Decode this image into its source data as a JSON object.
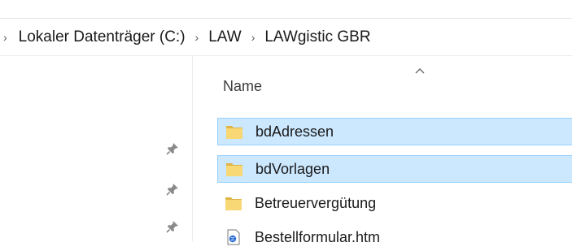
{
  "address_bar": {
    "segments": [
      "Lokaler Datenträger (C:)",
      "LAW",
      "LAWgistic GBR"
    ]
  },
  "nav_pane": {
    "pins": [
      "pin-icon",
      "pin-icon",
      "pin-icon"
    ]
  },
  "file_list": {
    "column_header": "Name",
    "sort_indicator": "chevron-up-icon",
    "items": [
      {
        "name": "bdAdressen",
        "type": "folder",
        "selected": true
      },
      {
        "name": "bdVorlagen",
        "type": "folder",
        "selected": true
      },
      {
        "name": "Betreuervergütung",
        "type": "folder",
        "selected": false
      },
      {
        "name": "Bestellformular.htm",
        "type": "htm-file",
        "selected": false
      }
    ]
  },
  "colors": {
    "selection_bg": "#cce8ff",
    "selection_border": "#99d1ff",
    "folder_yellow": "#f8d775",
    "folder_dark": "#e0b545"
  }
}
